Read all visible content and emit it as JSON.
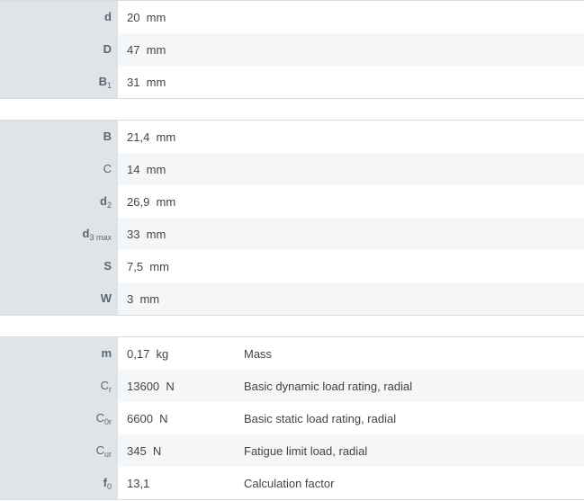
{
  "group1": [
    {
      "sym": "d",
      "sub": "",
      "value": "20  mm"
    },
    {
      "sym": "D",
      "sub": "",
      "value": "47  mm"
    },
    {
      "sym": "B",
      "sub": "1",
      "value": "31  mm"
    }
  ],
  "group2": [
    {
      "sym": "B",
      "sub": "",
      "value": "21,4  mm"
    },
    {
      "sym": "C",
      "sub": "",
      "value": "14  mm"
    },
    {
      "sym": "d",
      "sub": "2",
      "value": "26,9  mm"
    },
    {
      "sym": "d",
      "sub": "3 max",
      "value": "33  mm"
    },
    {
      "sym": "S",
      "sub": "",
      "value": "7,5  mm"
    },
    {
      "sym": "W",
      "sub": "",
      "value": "3  mm"
    }
  ],
  "group3": [
    {
      "sym": "m",
      "sub": "",
      "value": "0,17  kg",
      "desc": "Mass"
    },
    {
      "sym": "C",
      "sub": "r",
      "value": "13600  N",
      "desc": "Basic dynamic load rating, radial"
    },
    {
      "sym": "C",
      "sub": "0r",
      "value": "6600  N",
      "desc": "Basic static load rating, radial"
    },
    {
      "sym": "C",
      "sub": "ur",
      "value": "345  N",
      "desc": "Fatigue limit load, radial"
    },
    {
      "sym": "f",
      "sub": "0",
      "value": "13,1",
      "desc": "Calculation factor"
    }
  ]
}
